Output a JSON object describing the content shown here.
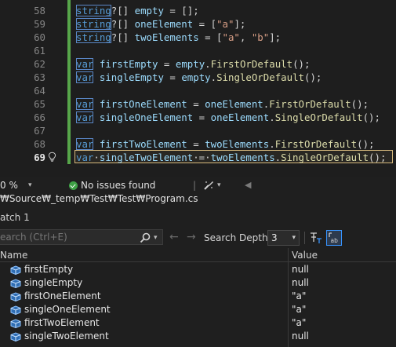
{
  "editor": {
    "lines": [
      {
        "num": "58",
        "tokens": [
          [
            "kw",
            "string"
          ],
          [
            "pu",
            "?[] "
          ],
          [
            "id",
            "empty"
          ],
          [
            "pu",
            " = [];"
          ]
        ]
      },
      {
        "num": "59",
        "tokens": [
          [
            "kw",
            "string"
          ],
          [
            "pu",
            "?[] "
          ],
          [
            "id",
            "oneElement"
          ],
          [
            "pu",
            " = ["
          ],
          [
            "st",
            "\"a\""
          ],
          [
            "pu",
            "];"
          ]
        ]
      },
      {
        "num": "60",
        "tokens": [
          [
            "kw",
            "string"
          ],
          [
            "pu",
            "?[] "
          ],
          [
            "id",
            "twoElements"
          ],
          [
            "pu",
            " = ["
          ],
          [
            "st",
            "\"a\""
          ],
          [
            "pu",
            ", "
          ],
          [
            "st",
            "\"b\""
          ],
          [
            "pu",
            "];"
          ]
        ]
      },
      {
        "num": "61",
        "tokens": []
      },
      {
        "num": "62",
        "tokens": [
          [
            "kw",
            "var"
          ],
          [
            "pu",
            " "
          ],
          [
            "id",
            "firstEmpty"
          ],
          [
            "pu",
            " = "
          ],
          [
            "id",
            "empty"
          ],
          [
            "pu",
            "."
          ],
          [
            "fn",
            "FirstOrDefault"
          ],
          [
            "pu",
            "();"
          ]
        ]
      },
      {
        "num": "63",
        "tokens": [
          [
            "kw",
            "var"
          ],
          [
            "pu",
            " "
          ],
          [
            "id",
            "singleEmpty"
          ],
          [
            "pu",
            " = "
          ],
          [
            "id",
            "empty"
          ],
          [
            "pu",
            "."
          ],
          [
            "fn",
            "SingleOrDefault"
          ],
          [
            "pu",
            "();"
          ]
        ]
      },
      {
        "num": "64",
        "tokens": []
      },
      {
        "num": "65",
        "tokens": [
          [
            "kw",
            "var"
          ],
          [
            "pu",
            " "
          ],
          [
            "id",
            "firstOneElement"
          ],
          [
            "pu",
            " = "
          ],
          [
            "id",
            "oneElement"
          ],
          [
            "pu",
            "."
          ],
          [
            "fn",
            "FirstOrDefault"
          ],
          [
            "pu",
            "();"
          ]
        ]
      },
      {
        "num": "66",
        "tokens": [
          [
            "kw",
            "var"
          ],
          [
            "pu",
            " "
          ],
          [
            "id",
            "singleOneElement"
          ],
          [
            "pu",
            " = "
          ],
          [
            "id",
            "oneElement"
          ],
          [
            "pu",
            "."
          ],
          [
            "fn",
            "SingleOrDefault"
          ],
          [
            "pu",
            "();"
          ]
        ]
      },
      {
        "num": "67",
        "tokens": []
      },
      {
        "num": "68",
        "tokens": [
          [
            "kw",
            "var"
          ],
          [
            "pu",
            " "
          ],
          [
            "id",
            "firstTwoElement"
          ],
          [
            "pu",
            " = "
          ],
          [
            "id",
            "twoElements"
          ],
          [
            "pu",
            "."
          ],
          [
            "fn",
            "FirstOrDefault"
          ],
          [
            "pu",
            "();"
          ]
        ]
      },
      {
        "num": "69",
        "tokens": [
          [
            "ty",
            "var"
          ],
          [
            "pu",
            "·"
          ],
          [
            "id",
            "singleTwoElement"
          ],
          [
            "pu",
            "·=·"
          ],
          [
            "id",
            "twoElements"
          ],
          [
            "pu",
            "."
          ],
          [
            "fn",
            "SingleOrDefault"
          ],
          [
            "pu",
            "();"
          ]
        ]
      }
    ],
    "active_line": "69"
  },
  "status": {
    "zoom": "0 %",
    "issues": "No issues found"
  },
  "path": "₩Source₩_temp₩Test₩Test₩Program.cs",
  "watch": {
    "title": "atch 1",
    "search_placeholder": "earch (Ctrl+E)",
    "search_depth_label": "Search Depth:",
    "search_depth_value": "3",
    "columns": {
      "name": "Name",
      "value": "Value"
    },
    "rows": [
      {
        "name": "firstEmpty",
        "value": "null"
      },
      {
        "name": "singleEmpty",
        "value": "null"
      },
      {
        "name": "firstOneElement",
        "value": "\"a\""
      },
      {
        "name": "singleOneElement",
        "value": "\"a\""
      },
      {
        "name": "firstTwoElement",
        "value": "\"a\""
      },
      {
        "name": "singleTwoElement",
        "value": "null"
      }
    ]
  },
  "colors": {
    "keyword": "#569cd6",
    "identifier": "#9cdcfe",
    "method": "#dcdcaa",
    "string": "#d69d85",
    "change_bar": "#57a64a",
    "ok_badge": "#3ea045"
  },
  "icons": [
    "lightbulb-icon",
    "check-circle-icon",
    "brush-icon",
    "chevron-down-icon",
    "chevron-left-icon",
    "search-icon",
    "arrow-left-icon",
    "arrow-right-icon",
    "pin-icon",
    "text-visualizer-icon",
    "object-icon"
  ]
}
